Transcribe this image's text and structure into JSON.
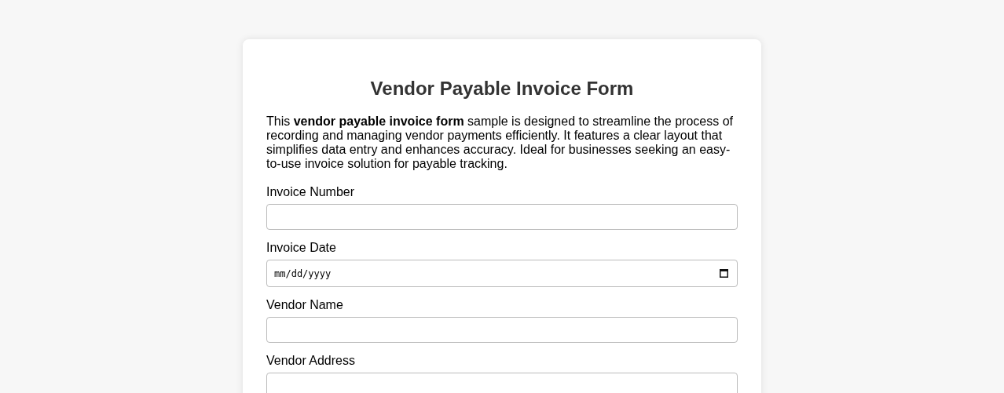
{
  "form": {
    "title": "Vendor Payable Invoice Form",
    "intro": "This **vendor payable invoice form** sample is designed to streamline the process of recording and managing vendor payments efficiently. It features a clear layout that simplifies data entry and enhances accuracy. Ideal for businesses seeking an easy-to-use invoice solution for payable tracking.",
    "fields": [
      {
        "label": "Invoice Number",
        "kind": "text"
      },
      {
        "label": "Invoice Date",
        "kind": "date",
        "placeholder": "mm/dd/yyyy"
      },
      {
        "label": "Vendor Name",
        "kind": "text"
      },
      {
        "label": "Vendor Address",
        "kind": "text"
      }
    ]
  }
}
